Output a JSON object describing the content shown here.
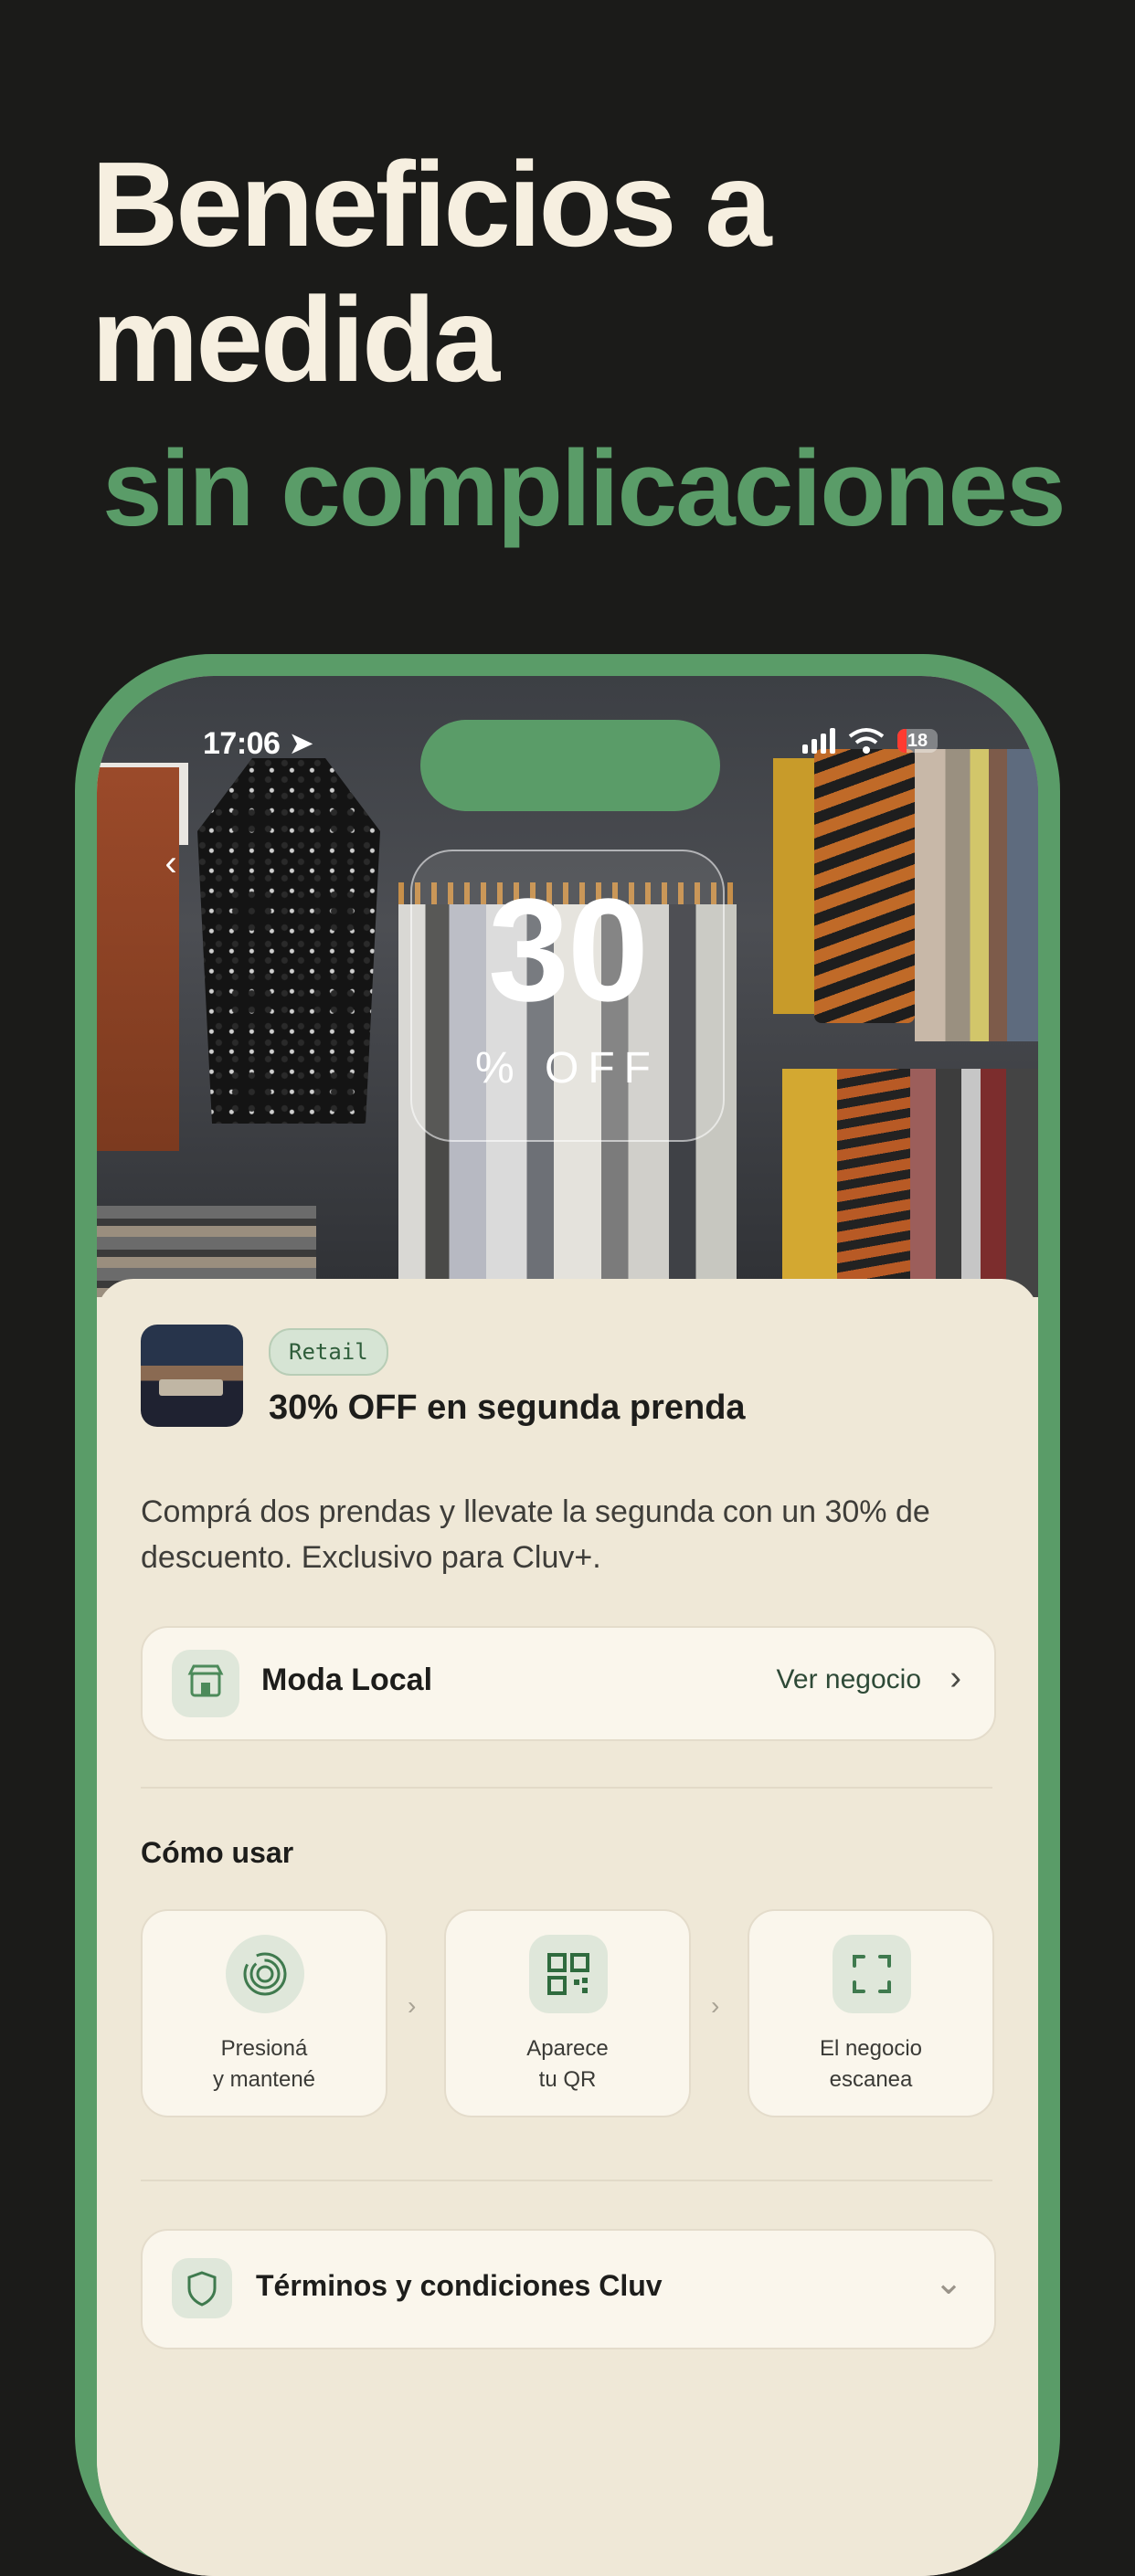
{
  "promo": {
    "headline_line1": "Beneficios a",
    "headline_line2": "medida",
    "headline_green": "sin complicaciones"
  },
  "status_bar": {
    "time": "17:06",
    "battery": "18"
  },
  "hero": {
    "discount_value": "30",
    "discount_label": "% OFF"
  },
  "offer": {
    "category_tag": "Retail",
    "title": "30% OFF en segunda prenda",
    "description": "Comprá dos prendas y llevate la segunda con un 30% de descuento. Exclusivo para Cluv+."
  },
  "business": {
    "name": "Moda Local",
    "link_label": "Ver negocio"
  },
  "how_to": {
    "title": "Cómo usar",
    "steps": [
      {
        "label": "Presioná\ny mantené",
        "icon": "fingerprint-icon"
      },
      {
        "label": "Aparece\ntu QR",
        "icon": "qr-code-icon"
      },
      {
        "label": "El negocio\nescanea",
        "icon": "scan-frame-icon"
      }
    ]
  },
  "terms": {
    "label": "Términos y condiciones Cluv"
  },
  "colors": {
    "brand_green": "#5a9c68",
    "background": "#1b1b19",
    "sheet": "#efe8d7"
  }
}
